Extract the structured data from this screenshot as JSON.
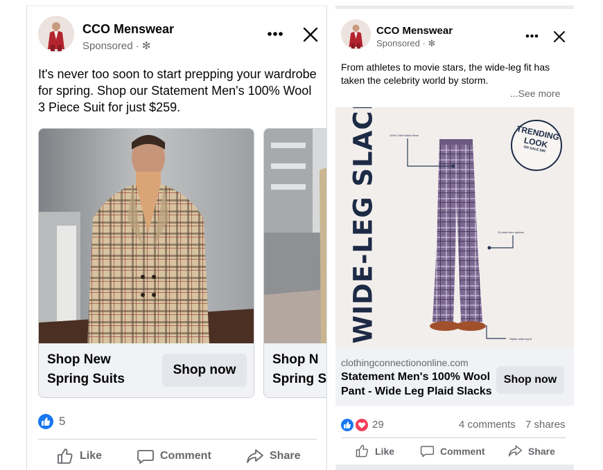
{
  "left_post": {
    "page_name": "CCO Menswear",
    "sponsored": "Sponsored",
    "caption": "It's never too soon to start prepping your wardrobe for spring. Shop our Statement Men's 100% Wool 3 Piece Suit for just $259.",
    "carousel": [
      {
        "title_line1": "Shop New",
        "title_line2": "Spring Suits",
        "cta": "Shop now"
      },
      {
        "title_line1": "Shop N",
        "title_line2": "Spring S",
        "cta": ""
      }
    ],
    "reaction_count": "5",
    "actions": {
      "like": "Like",
      "comment": "Comment",
      "share": "Share"
    }
  },
  "right_post": {
    "page_name": "CCO Menswear",
    "sponsored": "Sponsored",
    "caption": "From athletes to movie stars, the wide-leg fit has taken the celebrity world by storm.",
    "see_more": "...See more",
    "image": {
      "headline": "WIDE-LEG SLACKS",
      "badge_line1": "TRENDING",
      "badge_line2": "LOOK",
      "badge_line3": "ON SALE $99",
      "callout_fabric": "100% 150s Italian Wool",
      "callout_colors": "10 plaid color options",
      "callout_fit": "Stylish wide-leg fit"
    },
    "link": {
      "domain": "clothingconnectiononline.com",
      "title": "Statement Men's 100% Wool Pant - Wide Leg Plaid Slacks",
      "cta": "Shop now"
    },
    "reaction_count": "29",
    "comments": "4 comments",
    "shares": "7 shares",
    "actions": {
      "like": "Like",
      "comment": "Comment",
      "share": "Share"
    }
  },
  "colors": {
    "facebook_blue": "#1877f2",
    "love_red": "#f33e58",
    "slacks_purple": "#7d6a92",
    "headline_navy": "#1c2a45"
  }
}
